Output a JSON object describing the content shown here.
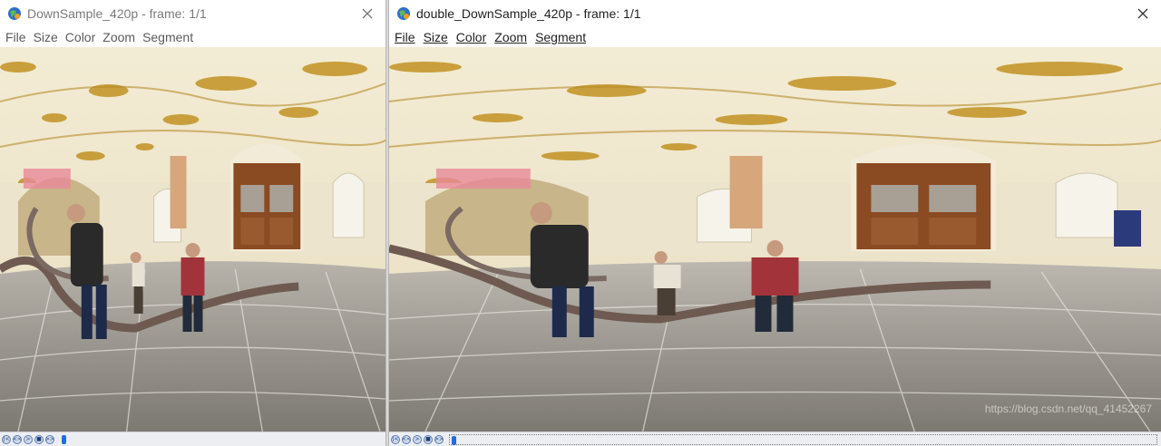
{
  "windows": [
    {
      "title": "DownSample_420p - frame: 1/1",
      "menu": [
        "File",
        "Size",
        "Color",
        "Zoom",
        "Segment"
      ]
    },
    {
      "title": "double_DownSample_420p - frame: 1/1",
      "menu": [
        "File",
        "Size",
        "Color",
        "Zoom",
        "Segment"
      ]
    }
  ],
  "watermark": "https://blog.csdn.net/qq_41452267",
  "icons": {
    "app": "globe-app-icon",
    "close": "close-icon",
    "player": [
      "rewind-start-icon",
      "step-back-icon",
      "play-icon",
      "stop-icon",
      "step-forward-icon"
    ]
  },
  "colors": {
    "ceiling": "#efe6c9",
    "gold": "#c79a2e",
    "floor": "#8a8680",
    "door": "#8a4a22",
    "slider_thumb": "#1f6ee0"
  }
}
